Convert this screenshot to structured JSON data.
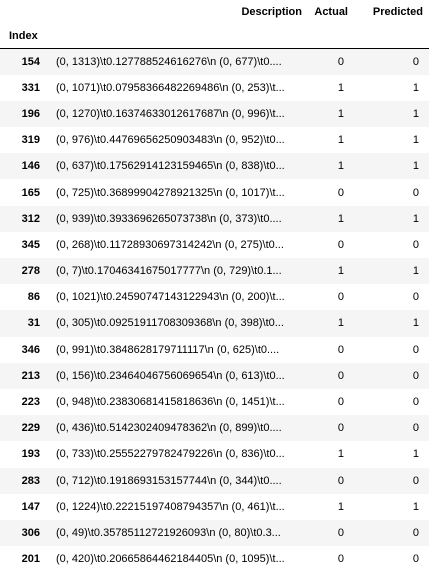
{
  "table": {
    "index_name": "Index",
    "columns": {
      "description": "Description",
      "actual": "Actual",
      "predicted": "Predicted"
    },
    "rows": [
      {
        "index": "154",
        "description": "(0, 1313)\\t0.127788524616276\\n (0, 677)\\t0....",
        "actual": "0",
        "predicted": "0"
      },
      {
        "index": "331",
        "description": "(0, 1071)\\t0.07958366482269486\\n (0, 253)\\t...",
        "actual": "1",
        "predicted": "1"
      },
      {
        "index": "196",
        "description": "(0, 1270)\\t0.16374633012617687\\n (0, 996)\\t...",
        "actual": "1",
        "predicted": "1"
      },
      {
        "index": "319",
        "description": "(0, 976)\\t0.44769656250903483\\n (0, 952)\\t0...",
        "actual": "1",
        "predicted": "1"
      },
      {
        "index": "146",
        "description": "(0, 637)\\t0.17562914123159465\\n (0, 838)\\t0...",
        "actual": "1",
        "predicted": "1"
      },
      {
        "index": "165",
        "description": "(0, 725)\\t0.36899904278921325\\n (0, 1017)\\t...",
        "actual": "0",
        "predicted": "0"
      },
      {
        "index": "312",
        "description": "(0, 939)\\t0.3933696265073738\\n (0, 373)\\t0....",
        "actual": "1",
        "predicted": "1"
      },
      {
        "index": "345",
        "description": "(0, 268)\\t0.11728930697314242\\n (0, 275)\\t0...",
        "actual": "0",
        "predicted": "0"
      },
      {
        "index": "278",
        "description": "(0, 7)\\t0.17046341675017777\\n (0, 729)\\t0.1...",
        "actual": "1",
        "predicted": "1"
      },
      {
        "index": "86",
        "description": "(0, 1021)\\t0.24590747143122943\\n (0, 200)\\t...",
        "actual": "0",
        "predicted": "0"
      },
      {
        "index": "31",
        "description": "(0, 305)\\t0.09251911708309368\\n (0, 398)\\t0...",
        "actual": "1",
        "predicted": "1"
      },
      {
        "index": "346",
        "description": "(0, 991)\\t0.3848628179711117\\n (0, 625)\\t0....",
        "actual": "0",
        "predicted": "0"
      },
      {
        "index": "213",
        "description": "(0, 156)\\t0.23464046756069654\\n (0, 613)\\t0...",
        "actual": "0",
        "predicted": "0"
      },
      {
        "index": "223",
        "description": "(0, 948)\\t0.23830681415818636\\n (0, 1451)\\t...",
        "actual": "0",
        "predicted": "0"
      },
      {
        "index": "229",
        "description": "(0, 436)\\t0.5142302409478362\\n (0, 899)\\t0....",
        "actual": "0",
        "predicted": "0"
      },
      {
        "index": "193",
        "description": "(0, 733)\\t0.25552279782479226\\n (0, 836)\\t0...",
        "actual": "1",
        "predicted": "1"
      },
      {
        "index": "283",
        "description": "(0, 712)\\t0.1918693153157744\\n (0, 344)\\t0....",
        "actual": "0",
        "predicted": "0"
      },
      {
        "index": "147",
        "description": "(0, 1224)\\t0.22215197408794357\\n (0, 461)\\t...",
        "actual": "1",
        "predicted": "1"
      },
      {
        "index": "306",
        "description": "(0, 49)\\t0.35785112721926093\\n (0, 80)\\t0.3...",
        "actual": "0",
        "predicted": "0"
      },
      {
        "index": "201",
        "description": "(0, 420)\\t0.20665864462184405\\n (0, 1095)\\t...",
        "actual": "0",
        "predicted": "0"
      }
    ]
  }
}
